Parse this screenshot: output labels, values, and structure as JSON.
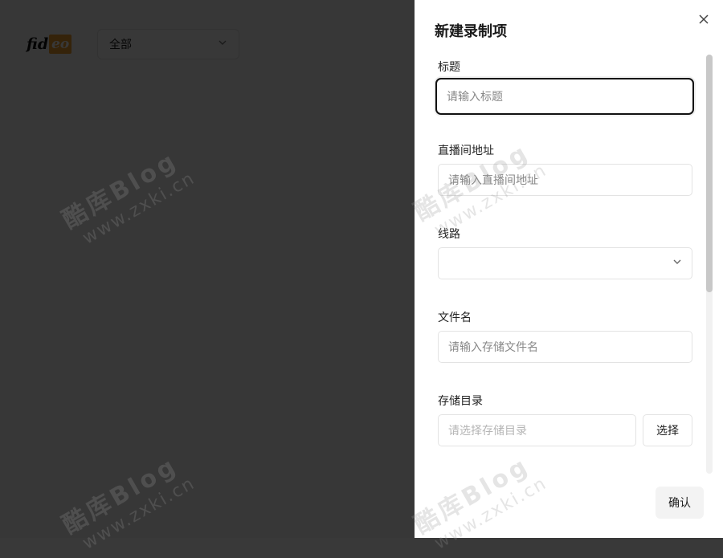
{
  "background": {
    "logo_text_a": "fid",
    "logo_text_b": "eo",
    "filter_value": "全部"
  },
  "watermark": {
    "line1": "酷库Blog",
    "line2": "www.zxki.cn"
  },
  "drawer": {
    "title": "新建录制项",
    "fields": {
      "title": {
        "label": "标题",
        "placeholder": "请输入标题"
      },
      "room_url": {
        "label": "直播间地址",
        "placeholder": "请输入直播间地址"
      },
      "line": {
        "label": "线路",
        "value": ""
      },
      "filename": {
        "label": "文件名",
        "placeholder": "请输入存储文件名"
      },
      "storage_dir": {
        "label": "存储目录",
        "placeholder": "请选择存储目录",
        "button": "选择"
      }
    },
    "confirm": "确认"
  },
  "colors": {
    "overlay": "#393939",
    "drawer_bg": "#ffffff",
    "focus_border": "#111111"
  }
}
